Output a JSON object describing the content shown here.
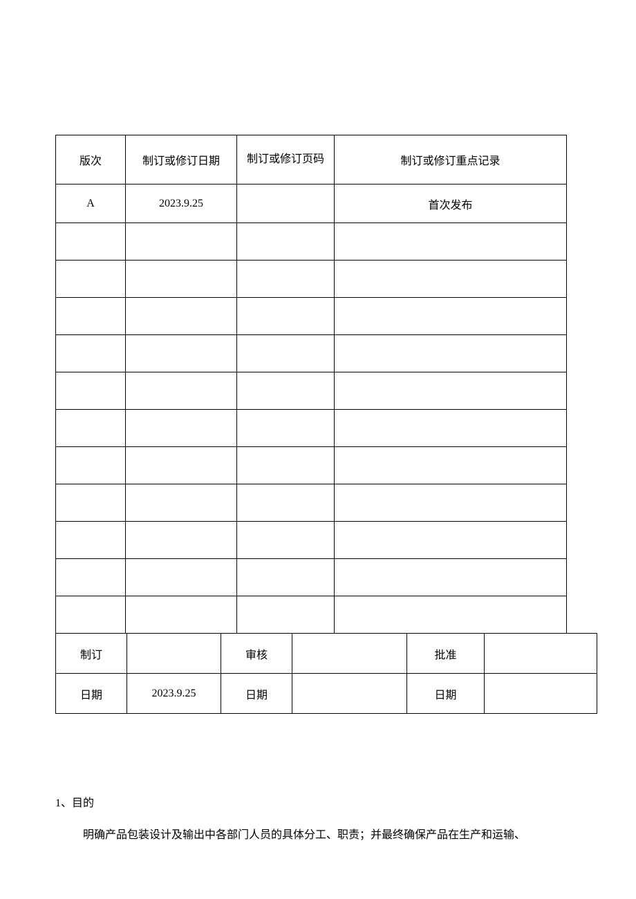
{
  "table": {
    "headers": {
      "version": "版次",
      "revise_date": "制订或修订日期",
      "page_code": "制订或修订页码",
      "record": "制订或修订重点记录"
    },
    "rows": [
      {
        "version": "A",
        "revise_date": "2023.9.25",
        "page_code": "",
        "record": "首次发布"
      },
      {
        "version": "",
        "revise_date": "",
        "page_code": "",
        "record": ""
      },
      {
        "version": "",
        "revise_date": "",
        "page_code": "",
        "record": ""
      },
      {
        "version": "",
        "revise_date": "",
        "page_code": "",
        "record": ""
      },
      {
        "version": "",
        "revise_date": "",
        "page_code": "",
        "record": ""
      },
      {
        "version": "",
        "revise_date": "",
        "page_code": "",
        "record": ""
      },
      {
        "version": "",
        "revise_date": "",
        "page_code": "",
        "record": ""
      },
      {
        "version": "",
        "revise_date": "",
        "page_code": "",
        "record": ""
      },
      {
        "version": "",
        "revise_date": "",
        "page_code": "",
        "record": ""
      },
      {
        "version": "",
        "revise_date": "",
        "page_code": "",
        "record": ""
      },
      {
        "version": "",
        "revise_date": "",
        "page_code": "",
        "record": ""
      },
      {
        "version": "",
        "revise_date": "",
        "page_code": "",
        "record": ""
      }
    ]
  },
  "signoff": {
    "prepare_label": "制订",
    "prepare_value": "",
    "review_label": "审核",
    "review_value": "",
    "approve_label": "批准",
    "approve_value": "",
    "date_label": "日期",
    "prepare_date": "2023.9.25",
    "review_date": "",
    "approve_date": ""
  },
  "section": {
    "heading": "1、目的",
    "body": "明确产品包装设计及输出中各部门人员的具体分工、职责；并最终确保产品在生产和运输、"
  }
}
